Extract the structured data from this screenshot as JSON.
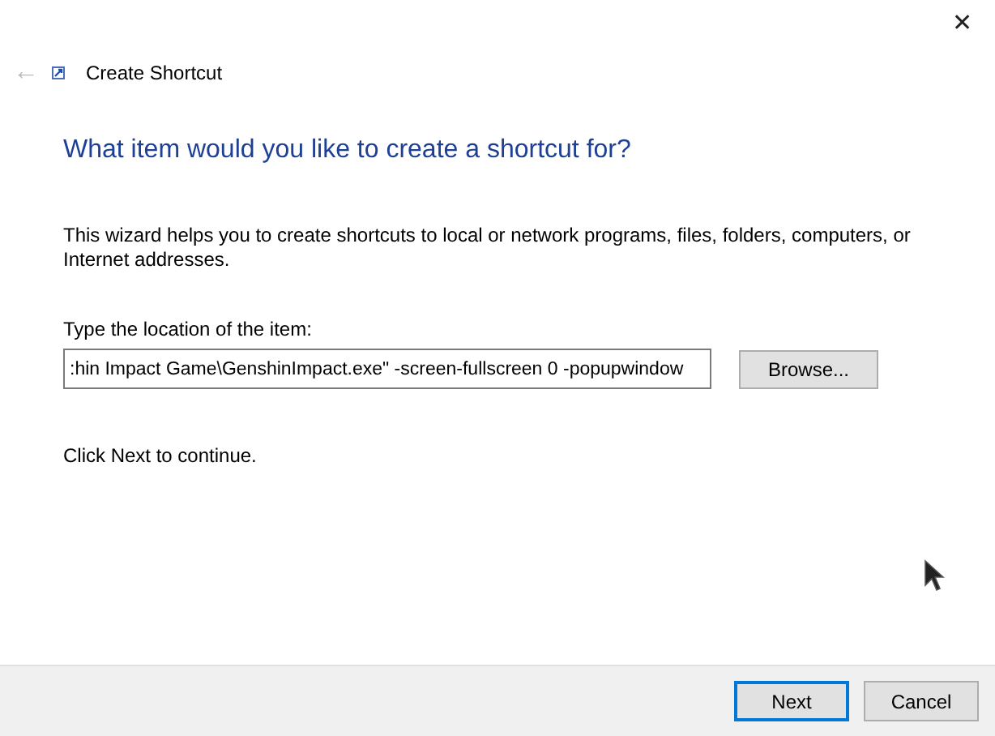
{
  "window": {
    "title": "Create Shortcut",
    "close": "✕",
    "back": "←"
  },
  "heading": "What item would you like to create a shortcut for?",
  "description": "This wizard helps you to create shortcuts to local or network programs, files, folders, computers, or Internet addresses.",
  "location": {
    "label": "Type the location of the item:",
    "value": ":hin Impact Game\\GenshinImpact.exe\" -screen-fullscreen 0 -popupwindow",
    "browse": "Browse..."
  },
  "hint": "Click Next to continue.",
  "buttons": [
    {
      "label": "Next",
      "default": true
    },
    {
      "label": "Cancel",
      "default": false
    }
  ]
}
